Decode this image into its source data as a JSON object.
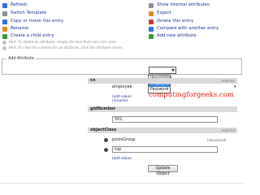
{
  "actions": {
    "left": [
      {
        "label": "Refresh",
        "icon": "refresh-icon"
      },
      {
        "label": "Switch Template",
        "icon": "template-icon"
      },
      {
        "label": "Copy or move this entry",
        "icon": "copy-icon"
      },
      {
        "label": "Rename",
        "icon": "rename-icon"
      },
      {
        "label": "Create a child entry",
        "icon": "create-child-icon"
      }
    ],
    "right": [
      {
        "label": "Show internal attributes",
        "icon": "internal-attributes-icon"
      },
      {
        "label": "Export",
        "icon": "export-icon"
      },
      {
        "label": "Delete this entry",
        "icon": "delete-icon"
      },
      {
        "label": "Compare with another entry",
        "icon": "compare-icon"
      },
      {
        "label": "Add new attribute",
        "icon": "add-attribute-icon"
      }
    ],
    "hints": [
      "Hint: To delete an attribute, empty the text field and click save.",
      "Hint: To view the schema for an attribute, click the attribute name."
    ]
  },
  "add_attribute": {
    "legend": "Add Attribute",
    "dropdown_options": [
      "description",
      "employeeType",
      "Password"
    ],
    "selected_index": 1
  },
  "attributes": {
    "cn": {
      "name": "cn",
      "badge": "required",
      "value": "employee",
      "add_value": "(add value)",
      "rename": "(rename)"
    },
    "gidNumber": {
      "name": "gidNumber",
      "value": "501"
    },
    "objectClass": {
      "name": "objectClass",
      "badge": "required",
      "values": [
        "posixGroup",
        "top"
      ],
      "structural": "(structural)",
      "add_value": "(add value)"
    }
  },
  "watermark": "computingforgeeks.com",
  "update_button": "Update Object"
}
